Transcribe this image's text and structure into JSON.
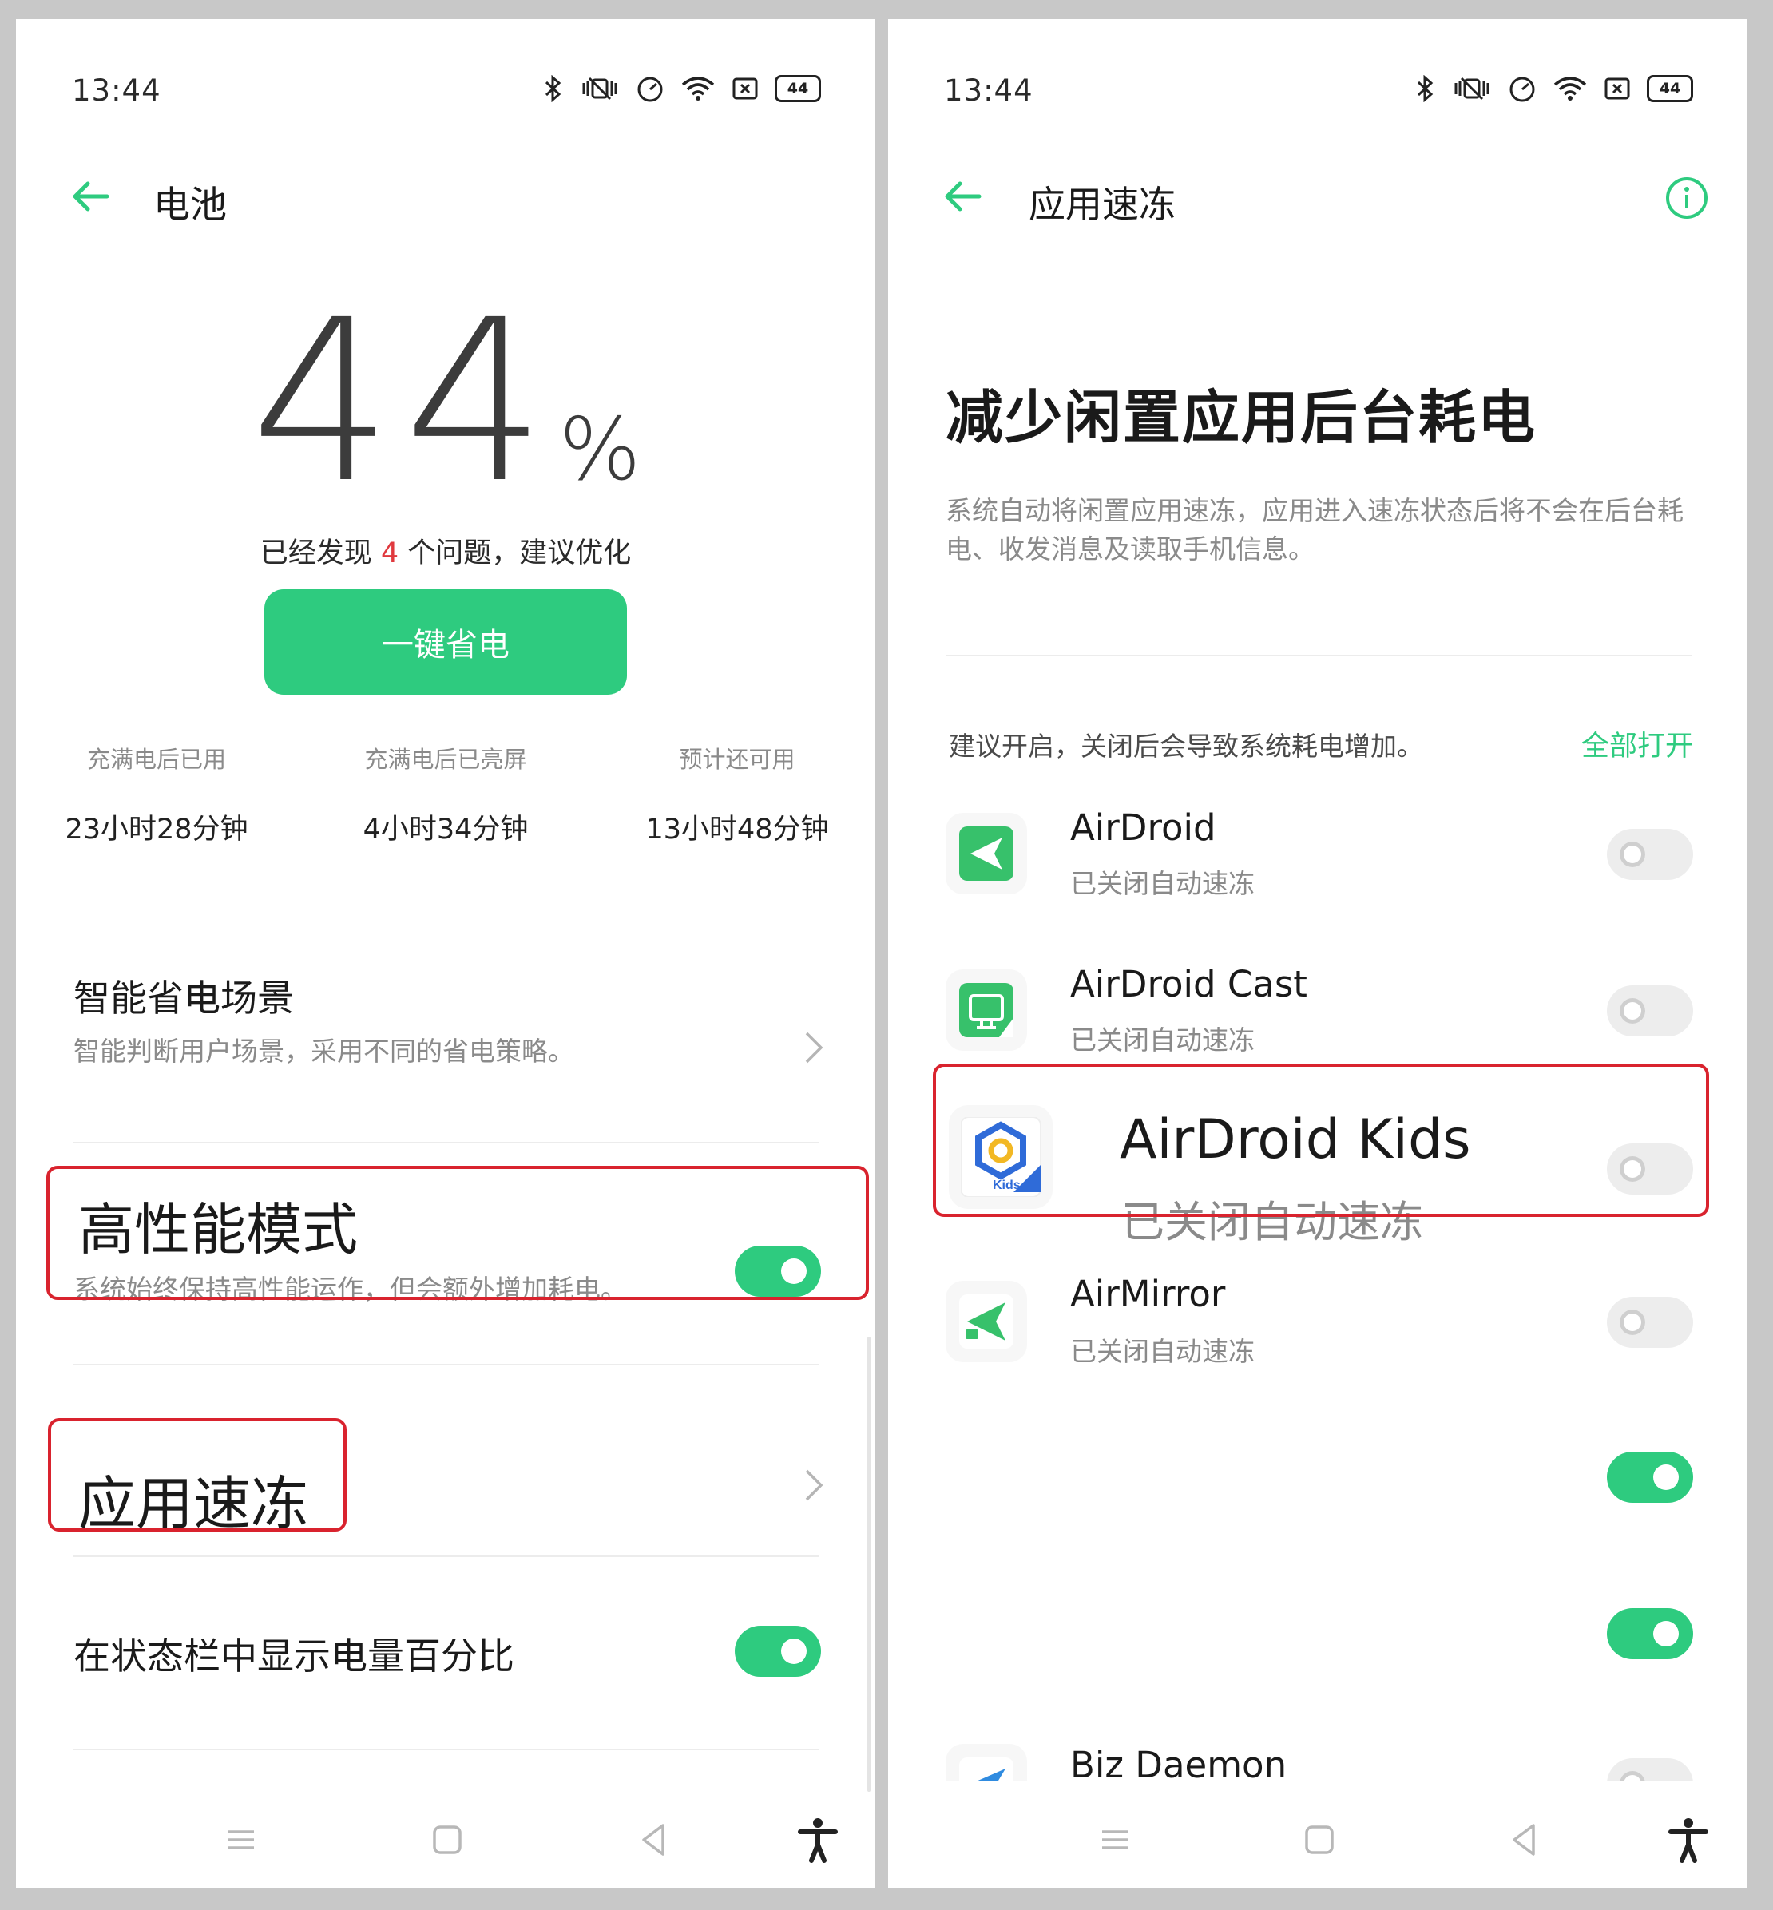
{
  "status_bar": {
    "time": "13:44",
    "battery_level": "44"
  },
  "left": {
    "header": {
      "title": "电池"
    },
    "battery": {
      "value": "44",
      "unit": "%"
    },
    "issues": {
      "prefix": "已经发现 ",
      "count": "4",
      "suffix": " 个问题，建议优化"
    },
    "save_button": "一键省电",
    "stats": [
      {
        "label": "充满电后已用",
        "value": "23小时28分钟"
      },
      {
        "label": "充满电后已亮屏",
        "value": "4小时34分钟"
      },
      {
        "label": "预计还可用",
        "value": "13小时48分钟"
      }
    ],
    "smart_scene": {
      "title": "智能省电场景",
      "subtitle": "智能判断用户场景，采用不同的省电策略。"
    },
    "high_perf": {
      "title": "高性能模式",
      "subtitle": "系统始终保持高性能运作，但会额外增加耗电。",
      "enabled": true
    },
    "app_freeze": {
      "title": "应用速冻"
    },
    "show_percent": {
      "title": "在状态栏中显示电量百分比",
      "enabled": true
    }
  },
  "right": {
    "header": {
      "title": "应用速冻"
    },
    "hero_title": "减少闲置应用后台耗电",
    "hero_desc": "系统自动将闲置应用速冻，应用进入速冻状态后将不会在后台耗电、收发消息及读取手机信息。",
    "suggestion": "建议开启，关闭后会导致系统耗电增加。",
    "open_all": "全部打开",
    "apps": [
      {
        "name": "AirDroid",
        "status": "已关闭自动速冻",
        "enabled": false,
        "icon": "airdroid-icon"
      },
      {
        "name": "AirDroid Cast",
        "status": "已关闭自动速冻",
        "enabled": false,
        "icon": "airdroid-cast-icon"
      },
      {
        "name": "AirDroid Kids",
        "status": "已关闭自动速冻",
        "enabled": false,
        "icon": "airdroid-kids-icon"
      },
      {
        "name": "AirMirror",
        "status": "已关闭自动速冻",
        "enabled": false,
        "icon": "airmirror-icon"
      },
      {
        "name": "",
        "status": "",
        "enabled": true,
        "icon": ""
      },
      {
        "name": "",
        "status": "",
        "enabled": true,
        "icon": ""
      },
      {
        "name": "Biz Daemon",
        "status": "",
        "enabled": false,
        "icon": "biz-daemon-icon"
      }
    ],
    "kids_icon_text": "Kids"
  },
  "colors": {
    "accent": "#2ecb7f",
    "highlight_box": "#d9232e",
    "issue_count": "#e0393e"
  }
}
